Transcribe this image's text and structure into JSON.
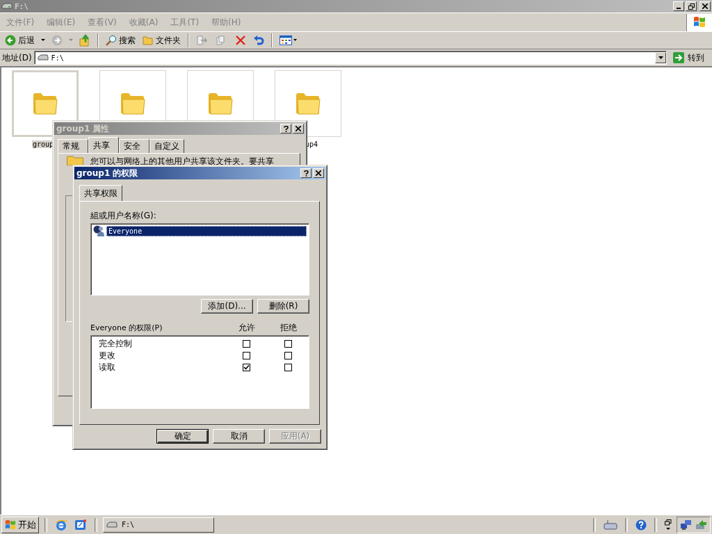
{
  "window": {
    "title": "F:\\"
  },
  "menu": [
    "文件(F)",
    "编辑(E)",
    "查看(V)",
    "收藏(A)",
    "工具(T)",
    "帮助(H)"
  ],
  "toolbar": {
    "back": "后退",
    "search": "搜索",
    "folders": "文件夹"
  },
  "address": {
    "label": "地址(D)",
    "value": "F:\\",
    "go": "转到"
  },
  "folders": [
    {
      "label": "group",
      "selected": true
    },
    {
      "selected": false
    },
    {
      "selected": false
    },
    {
      "label": "up4",
      "selected": false
    }
  ],
  "properties_dialog": {
    "title": "group1 属性",
    "active": false,
    "tabs": [
      {
        "label": "常规",
        "selected": false
      },
      {
        "label": "共享",
        "selected": true
      },
      {
        "label": "安全",
        "selected": false
      },
      {
        "label": "自定义",
        "selected": false
      }
    ],
    "text": "您可以与网络上的其他用户共享该文件夹。要共享"
  },
  "permissions_dialog": {
    "title": "group1 的权限",
    "active": true,
    "tab": "共享权限",
    "users_label": "組或用户名称(G):",
    "users": [
      {
        "name": "Everyone",
        "selected": true
      }
    ],
    "add": "添加(D)...",
    "remove": "删除(R)",
    "perm_label": "Everyone 的权限(P)",
    "columns": [
      "允许",
      "拒绝"
    ],
    "permissions": [
      {
        "name": "完全控制",
        "allow": false,
        "deny": false
      },
      {
        "name": "更改",
        "allow": false,
        "deny": false
      },
      {
        "name": "读取",
        "allow": true,
        "deny": false
      }
    ],
    "buttons": [
      {
        "label": "确定",
        "default": true,
        "disabled": false
      },
      {
        "label": "取消",
        "default": false,
        "disabled": false
      },
      {
        "label": "应用(A)",
        "default": false,
        "disabled": true
      }
    ]
  },
  "taskbar": {
    "start": "开始",
    "tasks": [
      {
        "label": "F:\\"
      }
    ]
  }
}
